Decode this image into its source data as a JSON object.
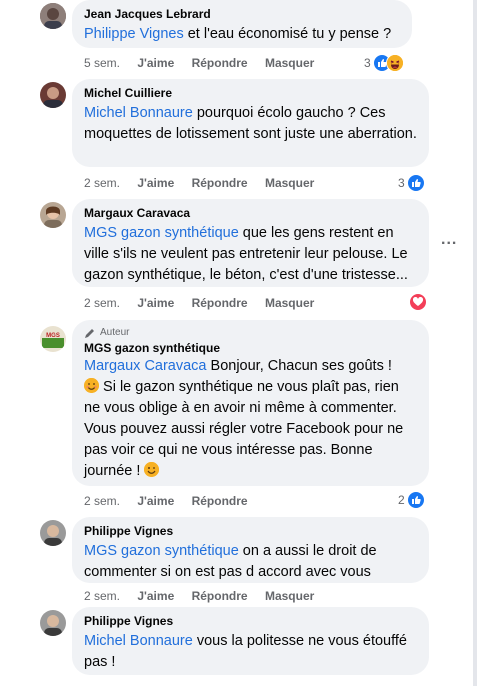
{
  "colors": {
    "mention": "#216fdb",
    "meta": "#65676b",
    "bubble": "#f0f2f5",
    "like": "#1877f2",
    "love": "#f33e58"
  },
  "actions": {
    "like": "J'aime",
    "reply": "Répondre",
    "hide": "Masquer"
  },
  "author_badge": "Auteur",
  "comments": [
    {
      "author": "Jean Jacques Lebrard",
      "mention": "Philippe Vignes",
      "text": " et l'eau économisé tu y pense ?",
      "time": "5 sem.",
      "reaction_count": "3",
      "reactions": [
        "like-icon",
        "haha-icon"
      ]
    },
    {
      "author": "Michel Cuilliere",
      "mention": "Michel Bonnaure",
      "text": " pourquoi écolo gaucho ? Ces moquettes de lotissement sont juste une aberration.",
      "time": "2 sem.",
      "reaction_count": "3",
      "reactions": [
        "like-icon"
      ]
    },
    {
      "author": "Margaux Caravaca",
      "mention": "MGS gazon synthétique",
      "text": " que les gens restent en ville s'ils ne veulent pas entretenir leur pelouse. Le gazon synthétique, le béton, c'est d'une tristesse...",
      "time": "2 sem.",
      "reaction_count": "",
      "reactions": [
        "love-icon"
      ],
      "more_label": "..."
    },
    {
      "author": "MGS gazon synthétique",
      "mention": "Margaux Caravaca",
      "text_1": " Bonjour, Chacun ses goûts !",
      "text_2": " Si le gazon synthétique ne vous plaît pas, rien ne vous oblige à en avoir ni même à commenter. Vous pouvez aussi régler votre Facebook pour ne pas voir ce qui ne vous intéresse pas. Bonne journée !",
      "time": "2 sem.",
      "reaction_count": "2",
      "reactions": [
        "like-icon"
      ]
    },
    {
      "author": "Philippe Vignes",
      "mention": "MGS gazon synthétique",
      "text": " on a aussi le droit de commenter si on est pas d accord avec vous",
      "time": "2 sem."
    },
    {
      "author": "Philippe Vignes",
      "mention": "Michel Bonnaure",
      "text": " vous la politesse ne vous étouffé pas !"
    }
  ]
}
